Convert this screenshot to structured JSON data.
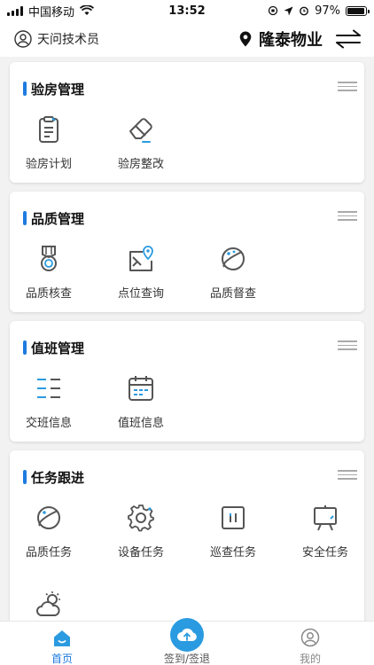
{
  "status_bar": {
    "carrier": "中国移动",
    "time": "13:52",
    "battery": "97%",
    "battery_level": 0.97
  },
  "header": {
    "user": "天问技术员",
    "location": "隆泰物业"
  },
  "sections": [
    {
      "title": "验房管理",
      "items": [
        {
          "label": "验房计划",
          "icon": "clipboard-icon"
        },
        {
          "label": "验房整改",
          "icon": "eraser-icon"
        }
      ]
    },
    {
      "title": "品质管理",
      "items": [
        {
          "label": "品质核查",
          "icon": "medal-icon"
        },
        {
          "label": "点位查询",
          "icon": "map-pin-icon"
        },
        {
          "label": "品质督查",
          "icon": "planet-icon"
        }
      ]
    },
    {
      "title": "值班管理",
      "items": [
        {
          "label": "交班信息",
          "icon": "list-icon"
        },
        {
          "label": "值班信息",
          "icon": "calendar-icon"
        }
      ]
    },
    {
      "title": "任务跟进",
      "items": [
        {
          "label": "品质任务",
          "icon": "planet-icon"
        },
        {
          "label": "设备任务",
          "icon": "gear-icon"
        },
        {
          "label": "巡查任务",
          "icon": "pause-box-icon"
        },
        {
          "label": "安全任务",
          "icon": "easel-icon"
        },
        {
          "label": "",
          "icon": "weather-icon"
        }
      ]
    }
  ],
  "tabs": [
    {
      "label": "首页",
      "icon": "home-icon",
      "active": true
    },
    {
      "label": "签到/签退",
      "icon": "cloud-upload-icon",
      "active": false
    },
    {
      "label": "我的",
      "icon": "user-icon",
      "active": false
    }
  ],
  "colors": {
    "accent": "#1e7be0",
    "icon": "#555555",
    "icon_accent": "#2a9be0",
    "background": "#f2f2f2"
  }
}
